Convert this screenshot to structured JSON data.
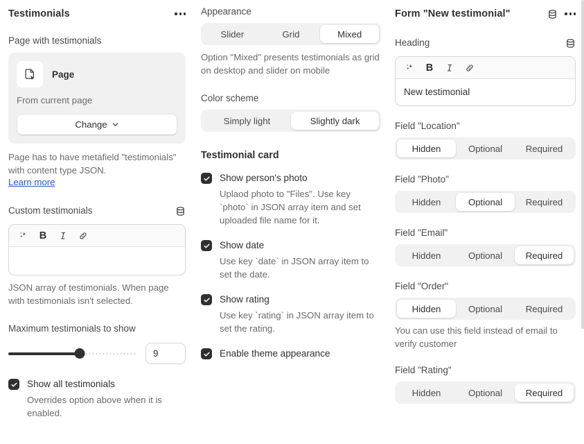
{
  "left_panel": {
    "title": "Testimonials",
    "more_menu": "…",
    "page_field": {
      "label": "Page with testimonials",
      "resource_name": "Page",
      "resource_source": "From current page",
      "change_button": "Change"
    },
    "page_help": "Page has to have metafield \"testimonials\" with content type JSON.",
    "learn_more": "Learn more",
    "custom_testimonials": {
      "label": "Custom testimonials",
      "editor_value": "",
      "toolbar": [
        "ai-sparkle-icon",
        "bold-icon",
        "italic-icon",
        "link-icon"
      ],
      "help": "JSON array of testimonials. When page with testimonials isn't selected."
    },
    "maximum": {
      "label": "Maximum testimonials to show",
      "value": "9",
      "min": 0,
      "max": 16,
      "fill_percent": 56
    },
    "show_all": {
      "label": "Show all testimonials",
      "checked": true,
      "help": "Overrides option above when it is enabled."
    }
  },
  "mid_panel": {
    "appearance": {
      "label": "Appearance",
      "options": [
        "Slider",
        "Grid",
        "Mixed"
      ],
      "selected": "Mixed",
      "help": "Option \"Mixed\" presents testimonials as grid on desktop and slider on mobile"
    },
    "color_scheme": {
      "label": "Color scheme",
      "options": [
        "Simply light",
        "Slightly dark"
      ],
      "selected": "Slightly dark"
    },
    "card_section_title": "Testimonial card",
    "checkboxes": [
      {
        "label": "Show person's photo",
        "checked": true,
        "help": "Uplaod photo to \"Files\". Use key `photo` in JSON array item and set uploaded file name for it."
      },
      {
        "label": "Show date",
        "checked": true,
        "help": "Use key `date` in JSON array item to set the date."
      },
      {
        "label": "Show rating",
        "checked": true,
        "help": "Use key `rating` in JSON array item to set the rating."
      },
      {
        "label": "Enable theme appearance",
        "checked": true,
        "help": ""
      }
    ]
  },
  "right_panel": {
    "title": "Form \"New testimonial\"",
    "metafield_icon": "database-icon",
    "more_menu": "…",
    "heading": {
      "label": "Heading",
      "metafield_icon": "database-icon",
      "toolbar": [
        "ai-sparkle-icon",
        "bold-icon",
        "italic-icon",
        "link-icon"
      ],
      "value": "New testimonial"
    },
    "fields": [
      {
        "label": "Field \"Location\"",
        "options": [
          "Hidden",
          "Optional",
          "Required"
        ],
        "selected": "Hidden",
        "help": ""
      },
      {
        "label": "Field \"Photo\"",
        "options": [
          "Hidden",
          "Optional",
          "Required"
        ],
        "selected": "Optional",
        "help": ""
      },
      {
        "label": "Field \"Email\"",
        "options": [
          "Hidden",
          "Optional",
          "Required"
        ],
        "selected": "Required",
        "help": ""
      },
      {
        "label": "Field \"Order\"",
        "options": [
          "Hidden",
          "Optional",
          "Required"
        ],
        "selected": "Hidden",
        "help": "You can use this field instead of email to verify customer"
      },
      {
        "label": "Field \"Rating\"",
        "options": [
          "Hidden",
          "Optional",
          "Required"
        ],
        "selected": "Required",
        "help": ""
      }
    ]
  },
  "scrollbar": {
    "top_percent": 0,
    "height_percent": 74
  },
  "colors": {
    "text": "#303030",
    "muted": "#6a6a6a",
    "link": "#2754d8",
    "track": "#f1f1f1",
    "accent": "#303030",
    "border": "#d5d5d5"
  }
}
